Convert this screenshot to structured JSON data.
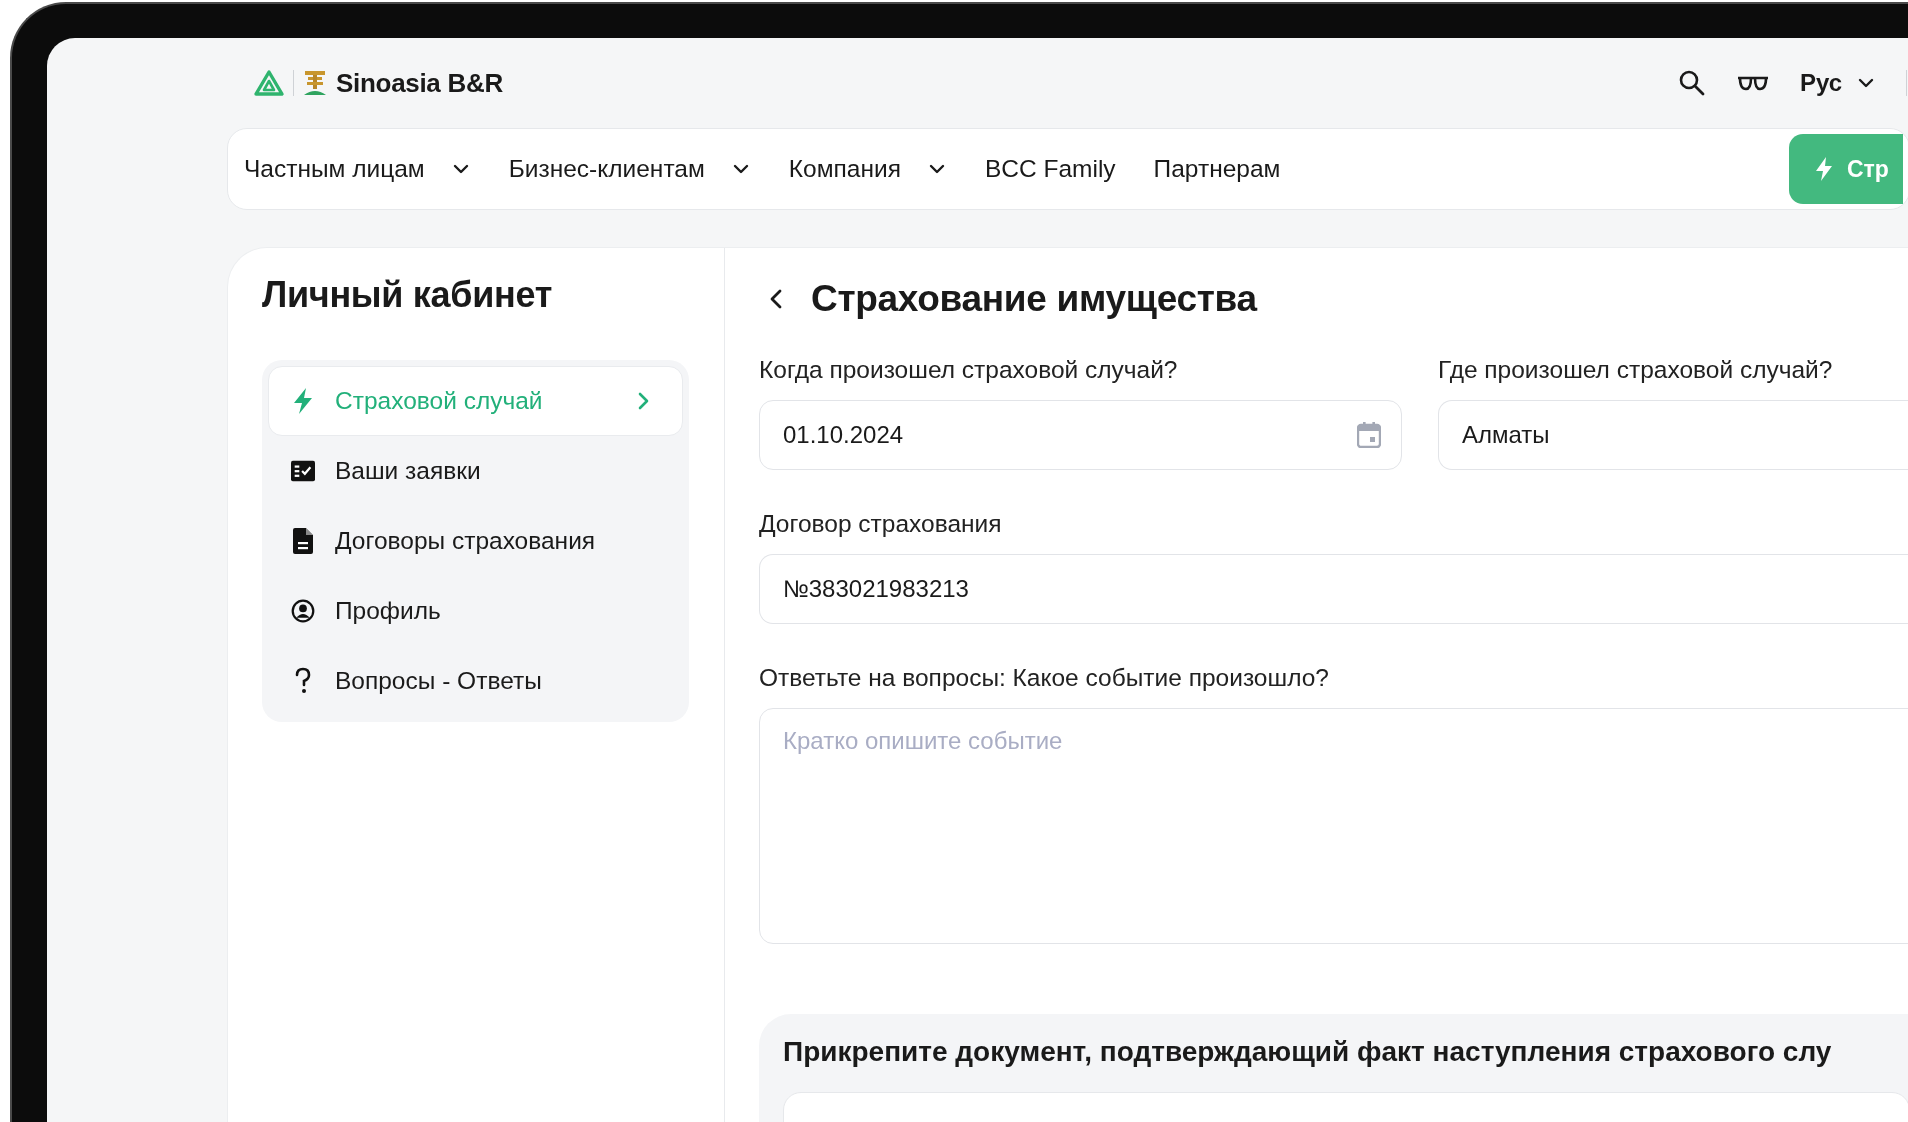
{
  "header": {
    "logo_text": "Sinoasia B&R",
    "language": "Рус"
  },
  "nav": {
    "items": [
      {
        "label": "Частным лицам",
        "dropdown": true
      },
      {
        "label": "Бизнес-клиентам",
        "dropdown": true
      },
      {
        "label": "Компания",
        "dropdown": true
      },
      {
        "label": "BCC Family",
        "dropdown": false
      },
      {
        "label": "Партнерам",
        "dropdown": false
      }
    ],
    "cta_button": "Стр"
  },
  "sidebar": {
    "title": "Личный кабинет",
    "items": [
      {
        "label": "Страховой случай",
        "selected": true
      },
      {
        "label": "Ваши заявки",
        "selected": false
      },
      {
        "label": "Договоры страхования",
        "selected": false
      },
      {
        "label": "Профиль",
        "selected": false
      },
      {
        "label": "Вопросы - Ответы",
        "selected": false
      }
    ]
  },
  "form": {
    "title": "Страхование имущества",
    "rows": [
      [
        {
          "kind": "date",
          "label": "Когда произошел страховой случай?",
          "value": "01.10.2024"
        },
        {
          "kind": "text",
          "label": "Где произошел страховой случай?",
          "value": "Алматы"
        }
      ],
      [
        {
          "kind": "text",
          "label": "Договор страхования",
          "value": "№383021983213"
        }
      ],
      [
        {
          "kind": "textarea",
          "label": "Ответьте на вопросы: Какое событие произошло?",
          "placeholder": "Кратко опишите событие"
        }
      ]
    ],
    "upload": {
      "title": "Прикрепите документ, подтверждающий факт наступления страхового слу"
    }
  }
}
